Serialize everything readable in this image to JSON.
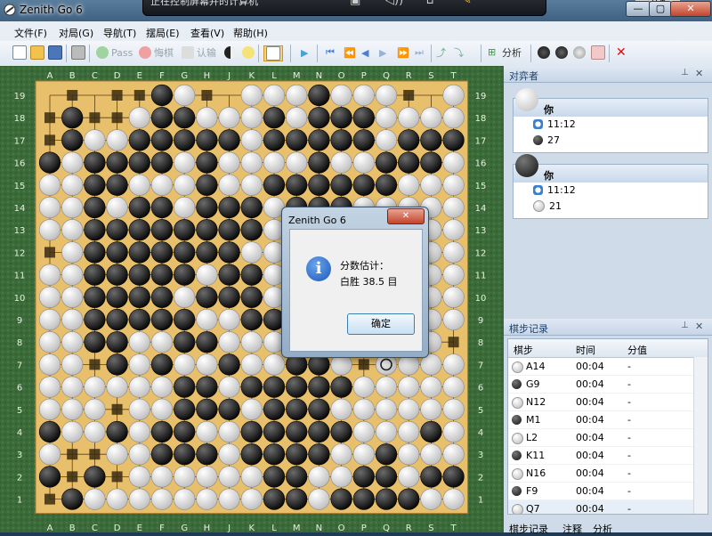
{
  "window": {
    "title": "Zenith Go 6",
    "min": "—",
    "max": "▢",
    "close": "✕"
  },
  "notice": {
    "text": "正在控制屏幕并的计算机",
    "finish": "结束"
  },
  "menu": [
    "文件(F)",
    "对局(G)",
    "导航(T)",
    "摆局(E)",
    "查看(V)",
    "帮助(H)"
  ],
  "toolbar": {
    "pass": "Pass",
    "undo": "悔棋",
    "resign": "认输",
    "analysis": "分析"
  },
  "board": {
    "columns": [
      "A",
      "B",
      "C",
      "D",
      "E",
      "F",
      "G",
      "H",
      "J",
      "K",
      "L",
      "M",
      "N",
      "O",
      "P",
      "Q",
      "R",
      "S",
      "T"
    ],
    "rows": [
      "19",
      "18",
      "17",
      "16",
      "15",
      "14",
      "13",
      "12",
      "11",
      "10",
      "9",
      "8",
      "7",
      "6",
      "5",
      "4",
      "3",
      "2",
      "1"
    ],
    "position": [
      ".x.xxbwx.wwwbwwwx.w",
      "xbxxwbbwwwbwbbbwwww",
      "xbwwbbbbbwbbbbbwbbb",
      "bwbbbbwbwwwwbwwbbbw",
      "wwbbwwwbwwbbbbbbwww",
      "wwbwbbwbbbwbbbwwwww",
      "wwbbbbbbbbwbbbwwwww",
      "xwbbbbbbbwwwbbwwwww",
      "wwbbbbbwbbwwbbbwbww",
      "wwbbbbwbbbwwbwwwbww",
      "wwbbbbbwwbbbbwwwbww",
      "wwbbwwbbwwwbbbwwwwx",
      "wwxbwbwwbwwbbwxwwww",
      "wwwwwwbbwbbbbbwwwww",
      "wwwxwwbbbwbbbwwwwww",
      "bwwbwbbwwbbbbbwwwbw",
      "wxxwwbbbwbbbbwwbwww",
      "bxbxwwwwwwbbwwbbwbb",
      "xbwwwwwwwwbbwbbbbww"
    ],
    "last_move": "Q7"
  },
  "players_panel": {
    "title": "对弈者",
    "players": [
      {
        "name": "你",
        "color": "white",
        "time": "11:12",
        "captures": "27",
        "capture_color": "black"
      },
      {
        "name": "你",
        "color": "black",
        "time": "11:12",
        "captures": "21",
        "capture_color": "white"
      }
    ]
  },
  "moves_panel": {
    "title": "棋步记录",
    "columns": [
      "棋步",
      "时间",
      "分值"
    ],
    "rows": [
      {
        "color": "white",
        "move": "A14",
        "time": "00:04",
        "score": "-"
      },
      {
        "color": "black",
        "move": "G9",
        "time": "00:04",
        "score": "-"
      },
      {
        "color": "white",
        "move": "N12",
        "time": "00:04",
        "score": "-"
      },
      {
        "color": "black",
        "move": "M1",
        "time": "00:04",
        "score": "-"
      },
      {
        "color": "white",
        "move": "L2",
        "time": "00:04",
        "score": "-"
      },
      {
        "color": "black",
        "move": "K11",
        "time": "00:04",
        "score": "-"
      },
      {
        "color": "white",
        "move": "N16",
        "time": "00:04",
        "score": "-"
      },
      {
        "color": "black",
        "move": "F9",
        "time": "00:04",
        "score": "-"
      },
      {
        "color": "white",
        "move": "Q7",
        "time": "00:04",
        "score": "-"
      }
    ],
    "tabs": [
      "棋步记录",
      "注释",
      "分析"
    ]
  },
  "dialog": {
    "title": "Zenith Go 6",
    "line1": "分数估计：",
    "line2": "白胜 38.5 目",
    "ok": "确定",
    "close": "✕"
  },
  "colors": {
    "board": "#e8bf6a",
    "territory_black": "#3a2a10",
    "territory_white": "#d8d8d8"
  }
}
